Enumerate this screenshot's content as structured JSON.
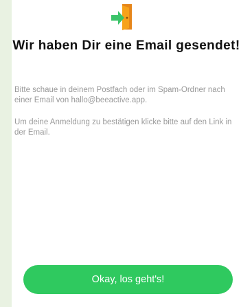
{
  "header": {
    "icon": "door-exit-icon",
    "title": "Wir haben Dir eine Email gesendet!"
  },
  "body": {
    "paragraph_1": "Bitte schaue in deinem Postfach oder im Spam-Ordner nach einer Email von hallo@beeactive.app.",
    "paragraph_2": "Um deine Anmeldung zu bestätigen klicke bitte auf den Link in der Email."
  },
  "actions": {
    "confirm_label": "Okay, los geht's!"
  },
  "colors": {
    "background": "#e9f2e2",
    "card": "#ffffff",
    "accent": "#2fc95f",
    "door": "#f7a21b",
    "arrow": "#3cc46a"
  }
}
